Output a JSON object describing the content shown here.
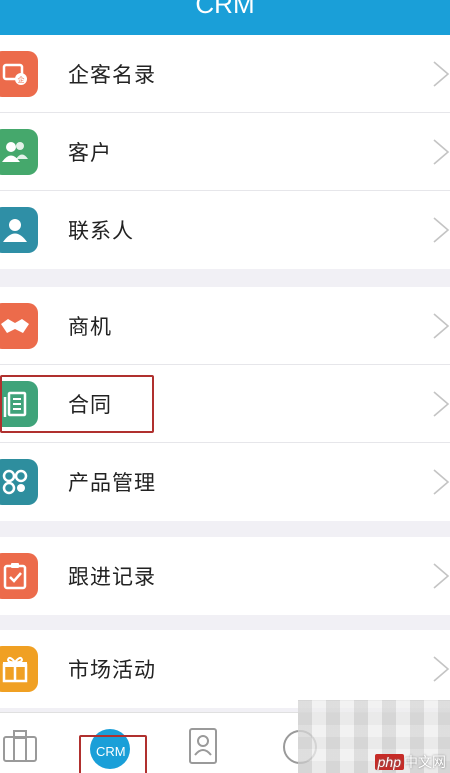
{
  "header": {
    "title": "CRM"
  },
  "groups": [
    {
      "items": [
        {
          "label": "企客名录",
          "icon": "company-directory-icon",
          "color": "#ec6b4b"
        },
        {
          "label": "客户",
          "icon": "customers-icon",
          "color": "#45a86c"
        },
        {
          "label": "联系人",
          "icon": "contact-icon",
          "color": "#2f8fa6"
        }
      ]
    },
    {
      "items": [
        {
          "label": "商机",
          "icon": "handshake-icon",
          "color": "#ec6b4b"
        },
        {
          "label": "合同",
          "icon": "contract-icon",
          "color": "#3fa37a"
        },
        {
          "label": "产品管理",
          "icon": "product-icon",
          "color": "#2e8e9e"
        }
      ]
    },
    {
      "items": [
        {
          "label": "跟进记录",
          "icon": "follow-up-icon",
          "color": "#ec6b4b"
        }
      ]
    },
    {
      "items": [
        {
          "label": "市场活动",
          "icon": "gift-icon",
          "color": "#f0a023"
        }
      ]
    }
  ],
  "tabbar": {
    "items": [
      {
        "icon": "briefcase-icon"
      },
      {
        "icon": "crm-icon",
        "label": "CRM",
        "active": true
      },
      {
        "icon": "contacts-book-icon"
      },
      {
        "icon": "more-icon"
      }
    ]
  },
  "watermark": {
    "brand": "php",
    "text": "中文网"
  },
  "colors": {
    "header": "#1a9fd8",
    "highlight": "#b0302e",
    "background": "#f1f0f5"
  }
}
